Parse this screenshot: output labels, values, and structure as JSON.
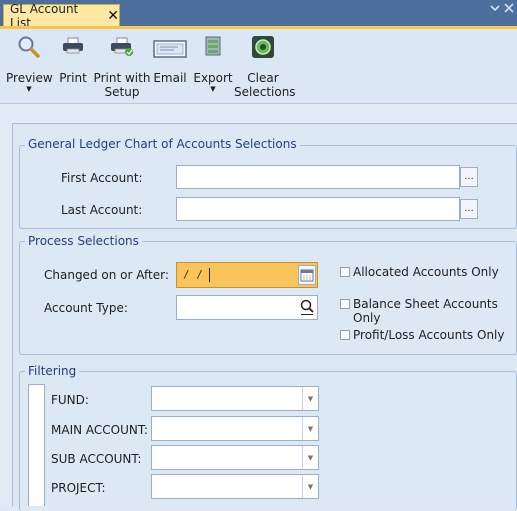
{
  "tab": {
    "title": "GL Account List",
    "close_glyph": "✕"
  },
  "toolbar": {
    "buttons": [
      {
        "label": "Preview",
        "has_menu": true
      },
      {
        "label": "Print",
        "has_menu": false
      },
      {
        "label": "Print with\nSetup",
        "has_menu": false
      },
      {
        "label": "Email",
        "has_menu": false
      },
      {
        "label": "Export",
        "has_menu": true
      },
      {
        "label": "Clear\nSelections",
        "has_menu": false
      }
    ],
    "menu_arrow_glyph": "▼"
  },
  "gl_group": {
    "legend": "General Ledger Chart of Accounts Selections",
    "first_account_label": "First Account:",
    "last_account_label": "Last Account:",
    "first_account_value": "",
    "last_account_value": "",
    "ellipsis": "..."
  },
  "process_group": {
    "legend": "Process Selections",
    "changed_label": "Changed on or After:",
    "changed_value": "/ /",
    "account_type_label": "Account Type:",
    "account_type_value": "",
    "checkboxes": [
      {
        "label": "Allocated Accounts Only",
        "checked": false
      },
      {
        "label": "Balance Sheet Accounts Only",
        "checked": false
      },
      {
        "label": "Profit/Loss Accounts Only",
        "checked": false
      }
    ]
  },
  "filter_group": {
    "legend": "Filtering",
    "rows": [
      {
        "label": "FUND:",
        "value": ""
      },
      {
        "label": "MAIN ACCOUNT:",
        "value": ""
      },
      {
        "label": "SUB ACCOUNT:",
        "value": ""
      },
      {
        "label": "PROJECT:",
        "value": ""
      }
    ],
    "arrow_glyph": "▼"
  },
  "colors": {
    "tab_bg": "#fde9a4",
    "accent_strip": "#f6c64a",
    "legend_text": "#1f3f7f",
    "date_field_bg": "#f9c45a",
    "header_bar": "#4d6f9e"
  }
}
